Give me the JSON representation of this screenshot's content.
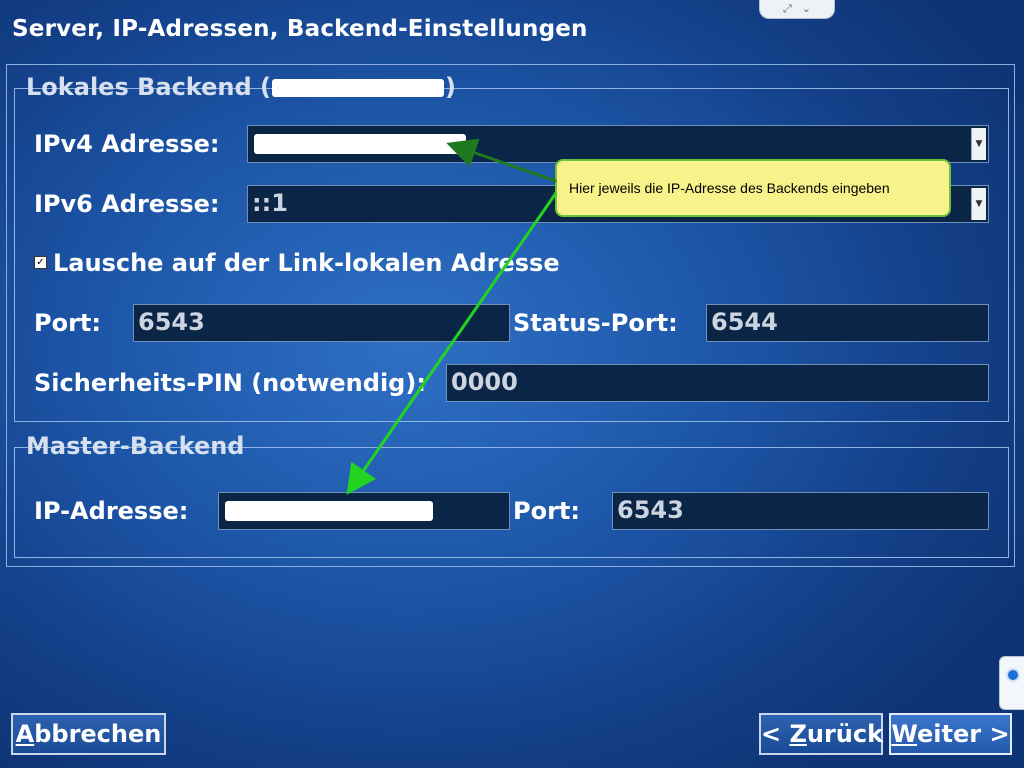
{
  "window": {
    "title": "Server, IP-Adressen, Backend-Einstellungen"
  },
  "local_backend": {
    "legend_prefix": "Lokales Backend (",
    "legend_suffix": ")",
    "ipv4_label": "IPv4 Adresse:",
    "ipv4_value": "",
    "ipv6_label": "IPv6 Adresse:",
    "ipv6_value": "::1",
    "link_local_checkbox_label": "Lausche auf der Link-lokalen Adresse",
    "link_local_checked": true,
    "port_label": "Port:",
    "port_value": "6543",
    "status_port_label": "Status-Port:",
    "status_port_value": "6544",
    "pin_label": "Sicherheits-PIN (notwendig):",
    "pin_value": "0000"
  },
  "master_backend": {
    "legend": "Master-Backend",
    "ip_label": "IP-Adresse:",
    "ip_value": "",
    "port_label": "Port:",
    "port_value": "6543"
  },
  "annotation": {
    "tooltip_text": "Hier jeweils die IP-Adresse des Backends eingeben",
    "arrow_color": "#22d422"
  },
  "buttons": {
    "cancel_mnemonic": "A",
    "cancel_rest": "bbrechen",
    "back_prefix": "< ",
    "back_mnemonic": "Z",
    "back_rest": "urück",
    "next_mnemonic": "W",
    "next_rest": "eiter >"
  },
  "icons": {
    "expand": "expand-icon",
    "collapse": "chevron-down-icon",
    "checkbox": "checkmark-icon",
    "combo_arrow": "dropdown-arrow-icon",
    "side_tab": "teamviewer-icon"
  },
  "colors": {
    "background": "#1d56a8",
    "field_bg": "#0b2547",
    "tooltip_bg": "#f7f28a"
  }
}
